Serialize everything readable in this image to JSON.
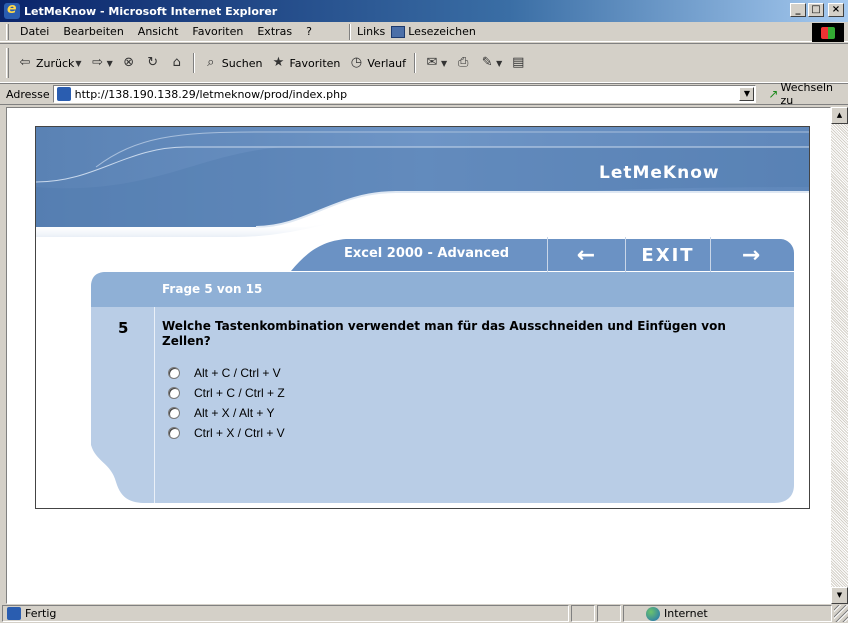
{
  "window": {
    "title": "LetMeKnow - Microsoft Internet Explorer",
    "controls": [
      "_",
      "□",
      "×"
    ]
  },
  "menubar": {
    "items": [
      "Datei",
      "Bearbeiten",
      "Ansicht",
      "Favoriten",
      "Extras",
      "?"
    ],
    "links_label": "Links",
    "bookmark_label": "Lesezeichen"
  },
  "toolbar": {
    "back_label": "Zurück",
    "search_label": "Suchen",
    "favorites_label": "Favoriten",
    "history_label": "Verlauf"
  },
  "addressbar": {
    "label": "Adresse",
    "url": "http://138.190.138.29/letmeknow/prod/index.php",
    "go_label": "Wechseln zu"
  },
  "app": {
    "brand": "LetMeKnow",
    "course_title": "Excel 2000 - Advanced",
    "nav": {
      "prev": "←",
      "exit": "EXIT",
      "next": "→"
    },
    "progress": "Frage 5 von 15",
    "question": {
      "number": "5",
      "text": "Welche Tastenkombination verwendet man für das Ausschneiden und Einfügen von Zellen?",
      "answers": [
        "Alt + C / Ctrl + V",
        "Ctrl + C / Ctrl + Z",
        "Alt + X / Alt + Y",
        "Ctrl + X / Ctrl + V"
      ]
    }
  },
  "statusbar": {
    "status": "Fertig",
    "zone": "Internet"
  },
  "colors": {
    "banner_dark": "#5a82b4",
    "banner_light": "#b7cbe4",
    "nav_bar": "#6b92c4",
    "progress_bar": "#8fb0d6",
    "question_panel": "#b9cde6"
  }
}
